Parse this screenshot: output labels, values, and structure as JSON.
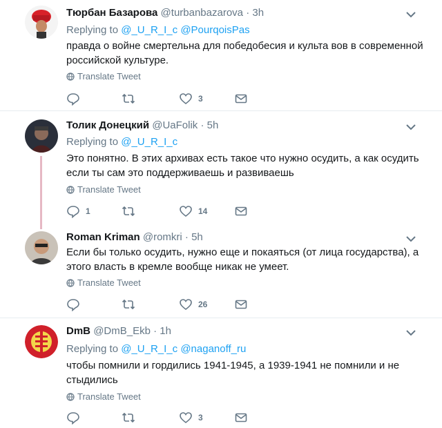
{
  "tweets": [
    {
      "name": "Тюрбан Базарова",
      "handle": "@turbanbazarova",
      "dot": "·",
      "time": "3h",
      "replying_prefix": "Replying to",
      "mentions": [
        "@_U_R_I_c",
        "@PourqoisPas"
      ],
      "text": "правда о войне смертельна для победобесия и культа вов в современной российской культуре.",
      "translate": "Translate Tweet",
      "replies": "",
      "retweets": "",
      "likes": "3"
    },
    {
      "name": "Толик Донецкий",
      "handle": "@UaFolik",
      "dot": "·",
      "time": "5h",
      "replying_prefix": "Replying to",
      "mentions": [
        "@_U_R_I_c"
      ],
      "text": "Это понятно. В этих архивах есть такое что нужно осудить, а как осудить если ты сам это поддерживаешь и развиваешь",
      "translate": "Translate Tweet",
      "replies": "1",
      "retweets": "",
      "likes": "14"
    },
    {
      "name": "Roman Kriman",
      "handle": "@romkri",
      "dot": "·",
      "time": "5h",
      "text": "Если бы только осудить, нужно еще и покаяться (от лица государства), а этого власть в кремле вообще никак не умеет.",
      "translate": "Translate Tweet",
      "replies": "",
      "retweets": "",
      "likes": "26"
    },
    {
      "name": "DmB",
      "handle": "@DmB_Ekb",
      "dot": "·",
      "time": "1h",
      "replying_prefix": "Replying to",
      "mentions": [
        "@_U_R_I_c",
        "@naganoff_ru"
      ],
      "text": "чтобы помнили и гордились 1941-1945, а 1939-1941 не помнили и не стыдились",
      "translate": "Translate Tweet",
      "replies": "",
      "retweets": "",
      "likes": "3"
    }
  ],
  "icons": {
    "reply": "reply-icon",
    "retweet": "retweet-icon",
    "like": "heart-icon",
    "message": "envelope-icon",
    "caret": "chevron-down-icon",
    "translate": "globe-icon"
  },
  "colors": {
    "link": "#1da1f2",
    "muted": "#657786",
    "text": "#14171a",
    "thread": "#e6b8c4",
    "separator": "#e6ecf0"
  }
}
